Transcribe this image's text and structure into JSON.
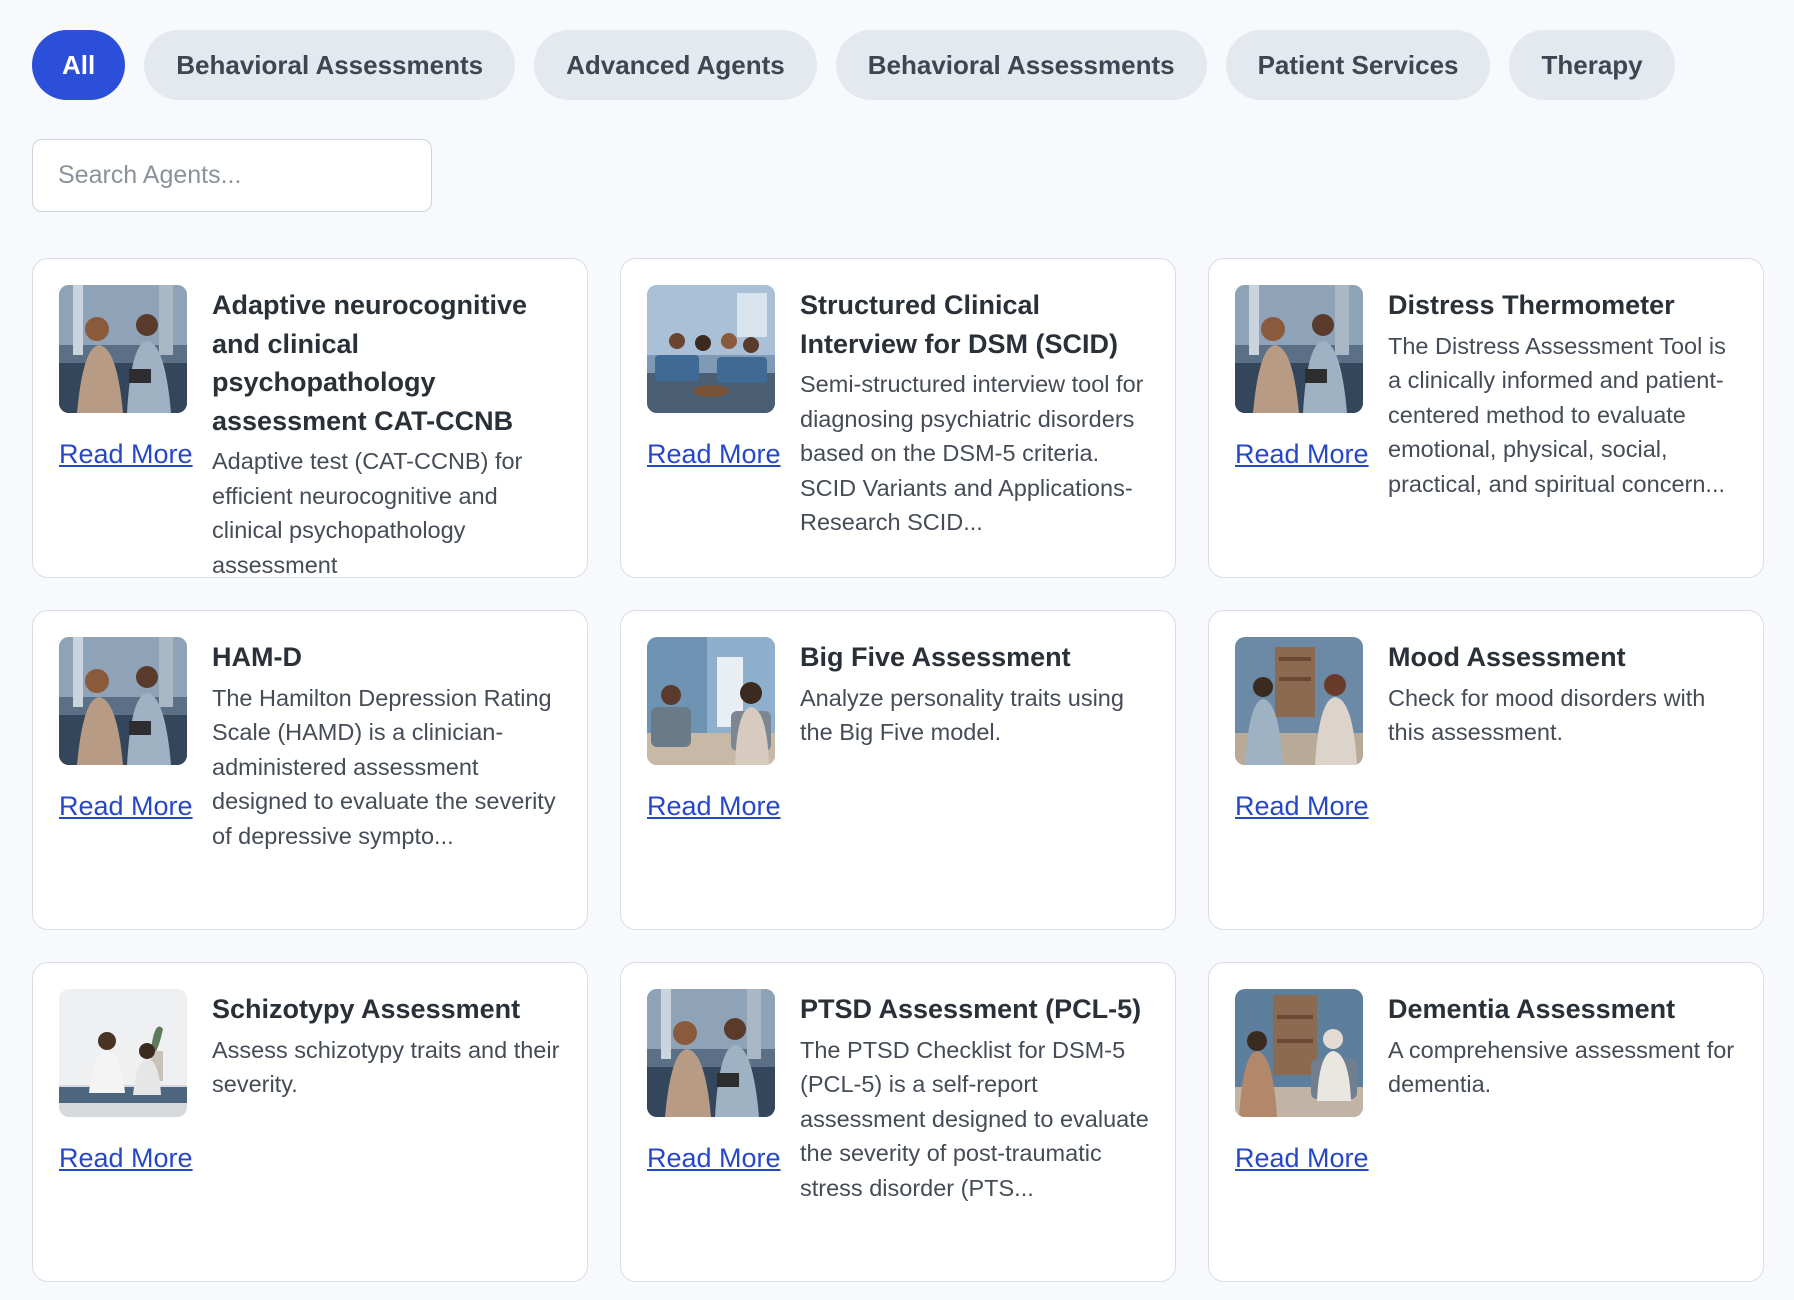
{
  "filters": [
    {
      "label": "All",
      "active": true
    },
    {
      "label": "Behavioral Assessments",
      "active": false
    },
    {
      "label": "Advanced Agents",
      "active": false
    },
    {
      "label": "Behavioral Assessments",
      "active": false
    },
    {
      "label": "Patient Services",
      "active": false
    },
    {
      "label": "Therapy",
      "active": false
    }
  ],
  "search": {
    "placeholder": "Search Agents...",
    "value": ""
  },
  "colors": {
    "accent": "#2b4fd8",
    "link": "#2747c9",
    "pill_bg": "#e4e8ef"
  },
  "cards": [
    {
      "title": "Adaptive neurocognitive and clinical psychopathology assessment CAT-CCNB",
      "description": "Adaptive test (CAT-CCNB) for efficient neurocognitive and clinical psychopathology assessment",
      "link_label": "Read More",
      "image": "therapy-session-two-women-photo"
    },
    {
      "title": "Structured Clinical Interview for DSM (SCID)",
      "description": "Semi-structured interview tool for diagnosing psychiatric disorders based on the DSM-5 criteria. SCID Variants and Applications- Research SCID...",
      "link_label": "Read More",
      "image": "group-therapy-session-photo"
    },
    {
      "title": "Distress Thermometer",
      "description": "The Distress Assessment Tool is a clinically informed and patient-centered method to evaluate emotional, physical, social, practical, and spiritual concern...",
      "link_label": "Read More",
      "image": "therapy-session-two-women-photo"
    },
    {
      "title": "HAM-D",
      "description": "The Hamilton Depression Rating Scale (HAMD) is a clinician-administered assessment designed to evaluate the severity of depressive sympto...",
      "link_label": "Read More",
      "image": "therapy-session-two-women-photo"
    },
    {
      "title": "Big Five Assessment",
      "description": "Analyze personality traits using the Big Five model.",
      "link_label": "Read More",
      "image": "counseling-room-photo"
    },
    {
      "title": "Mood Assessment",
      "description": "Check for mood disorders with this assessment.",
      "link_label": "Read More",
      "image": "counseling-man-woman-photo"
    },
    {
      "title": "Schizotypy Assessment",
      "description": "Assess schizotypy traits and their severity.",
      "link_label": "Read More",
      "image": "meditation-photo"
    },
    {
      "title": "PTSD Assessment (PCL-5)",
      "description": "The PTSD Checklist for DSM-5 (PCL-5) is a self-report assessment designed to evaluate the severity of post-traumatic stress disorder (PTS...",
      "link_label": "Read More",
      "image": "therapy-session-two-women-photo"
    },
    {
      "title": "Dementia Assessment",
      "description": "A comprehensive assessment for dementia.",
      "link_label": "Read More",
      "image": "elderly-counseling-photo"
    }
  ]
}
